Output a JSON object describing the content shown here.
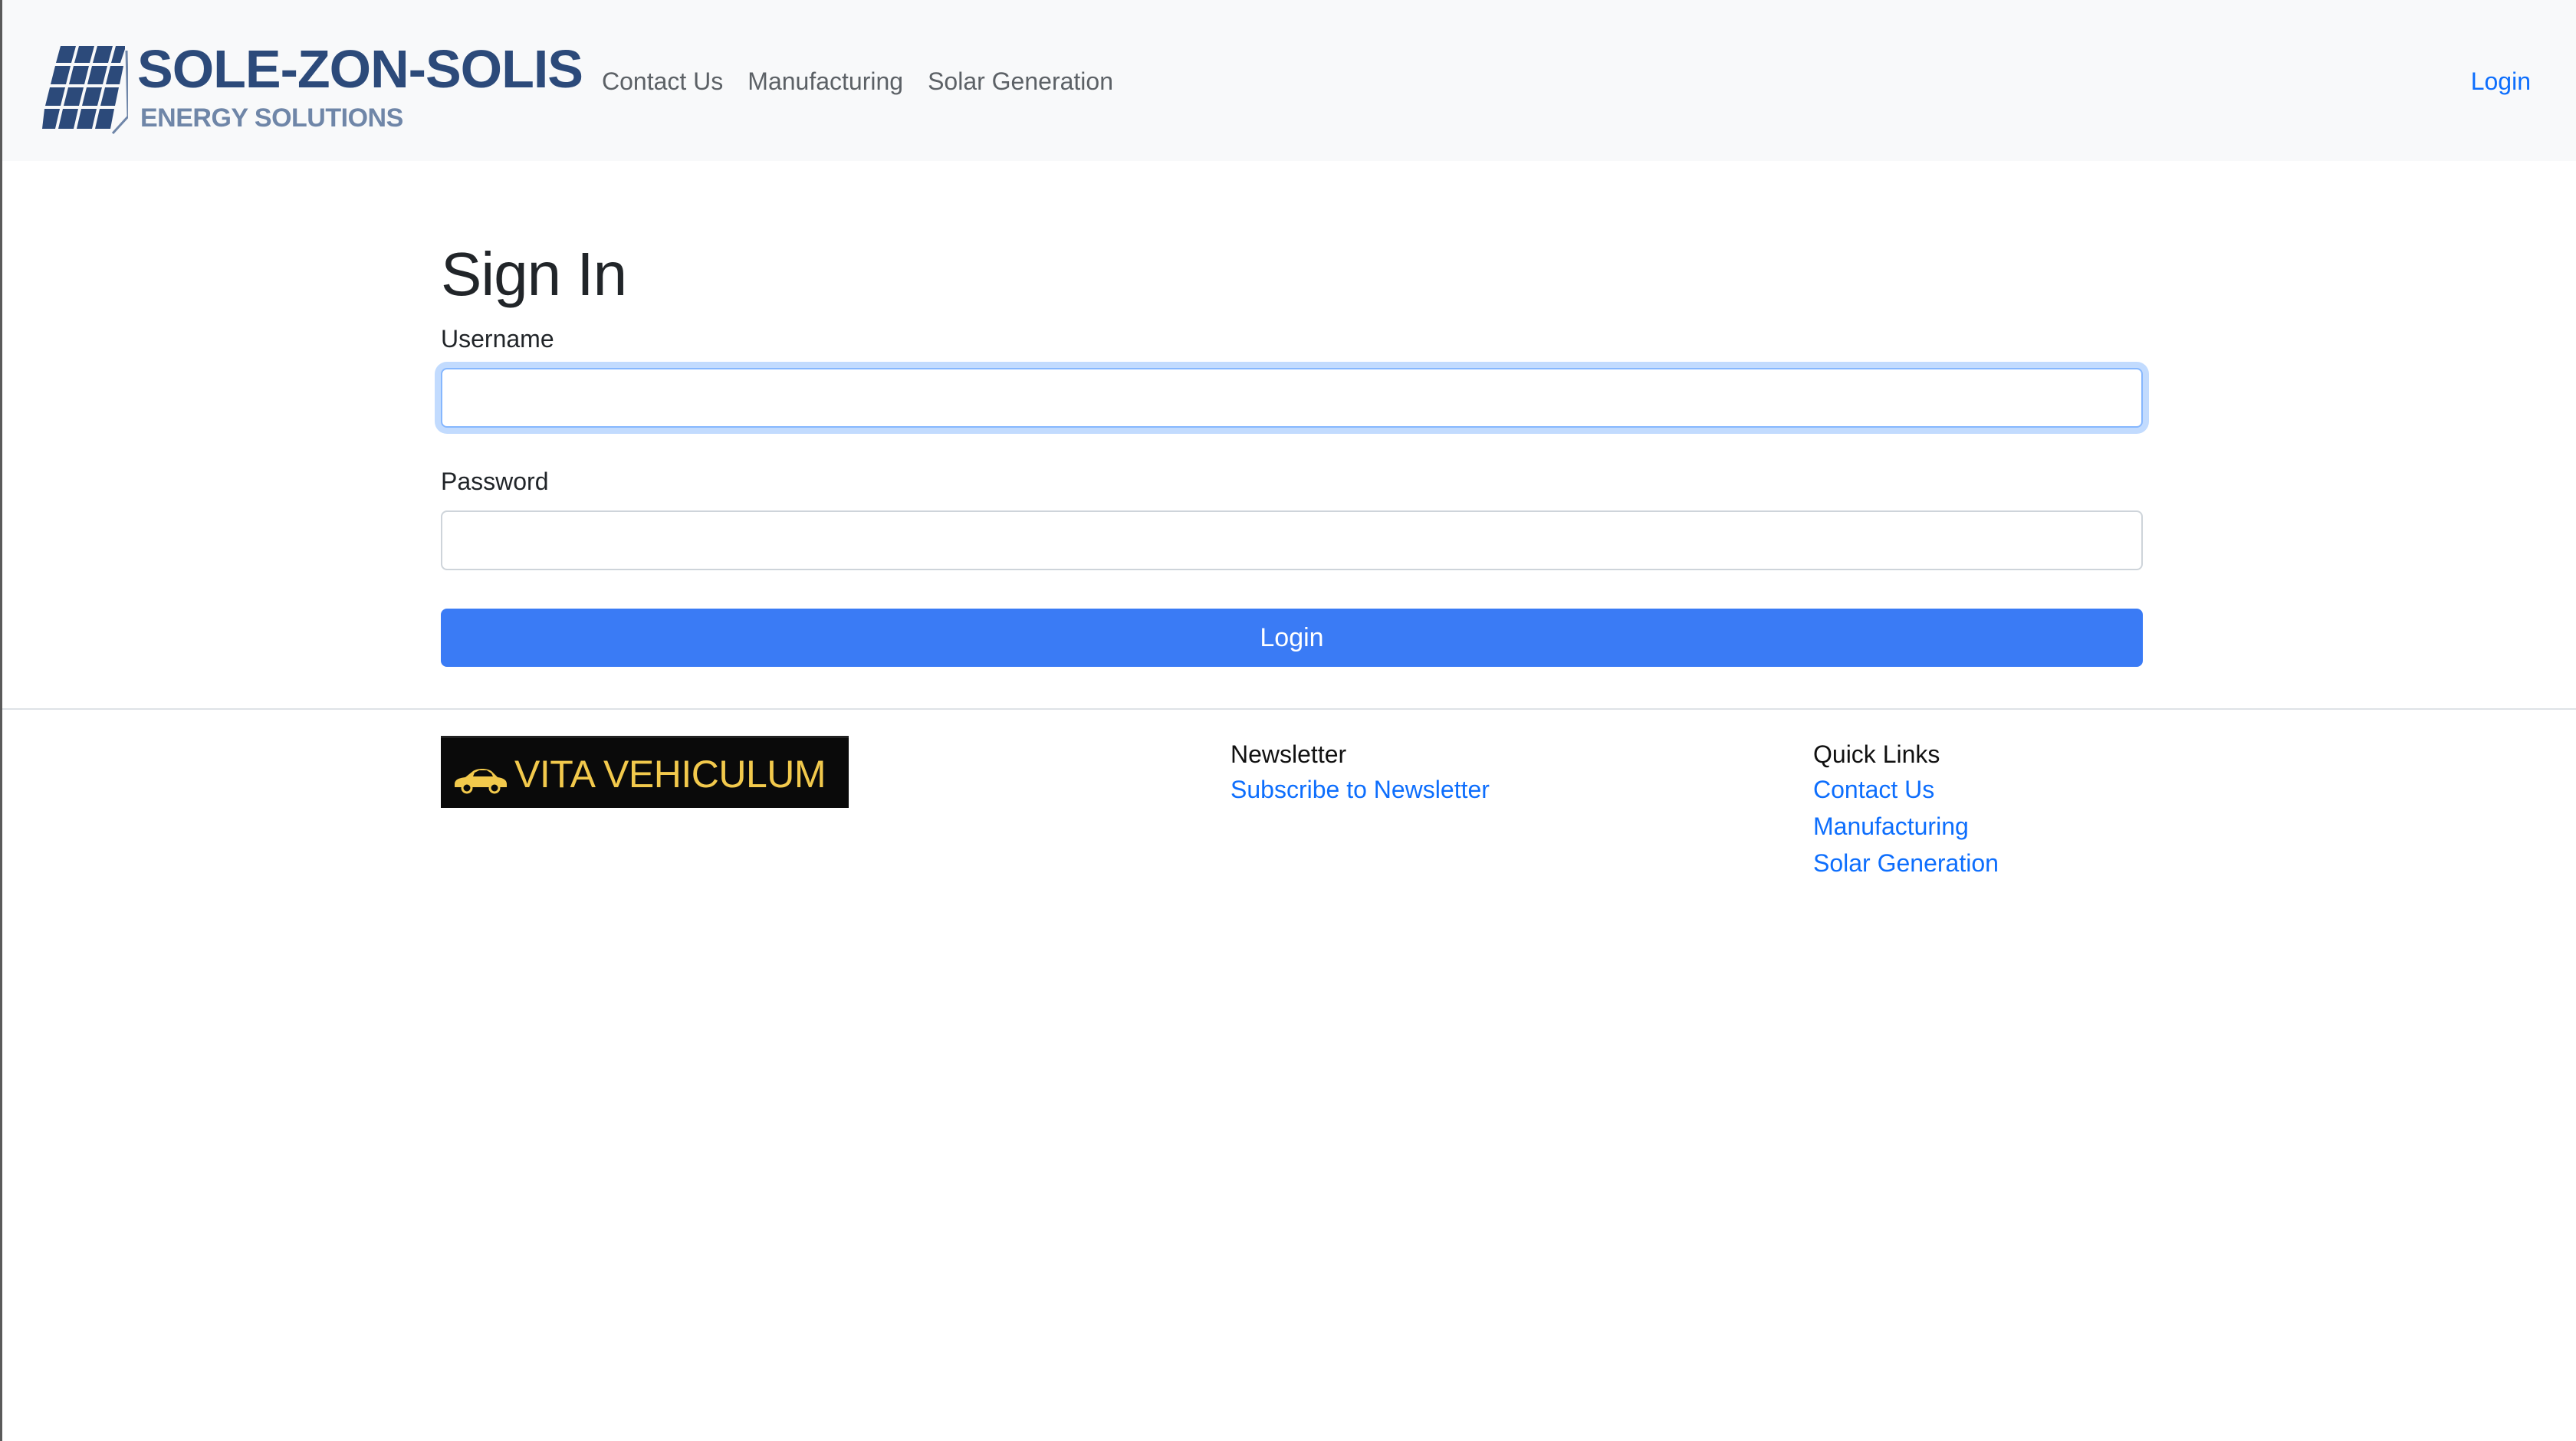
{
  "navbar": {
    "brand_title": "SOLE-ZON-SOLIS",
    "brand_subtitle": "ENERGY SOLUTIONS",
    "links": [
      "Contact Us",
      "Manufacturing",
      "Solar Generation"
    ],
    "login_label": "Login",
    "logo_icon": "solar-panel-icon"
  },
  "main": {
    "title": "Sign In",
    "username_label": "Username",
    "username_value": "",
    "password_label": "Password",
    "password_value": "",
    "login_button": "Login"
  },
  "footer": {
    "sponsor_text": "VITA VEHICULUM",
    "sponsor_icon": "car-icon",
    "newsletter_heading": "Newsletter",
    "newsletter_link": "Subscribe to Newsletter",
    "quick_links_heading": "Quick Links",
    "quick_links": [
      "Contact Us",
      "Manufacturing",
      "Solar Generation"
    ]
  },
  "colors": {
    "brand_blue": "#2c4a7a",
    "link_blue": "#0d6efd",
    "button_blue": "#3a7bf5",
    "sponsor_yellow": "#f2c94c"
  }
}
